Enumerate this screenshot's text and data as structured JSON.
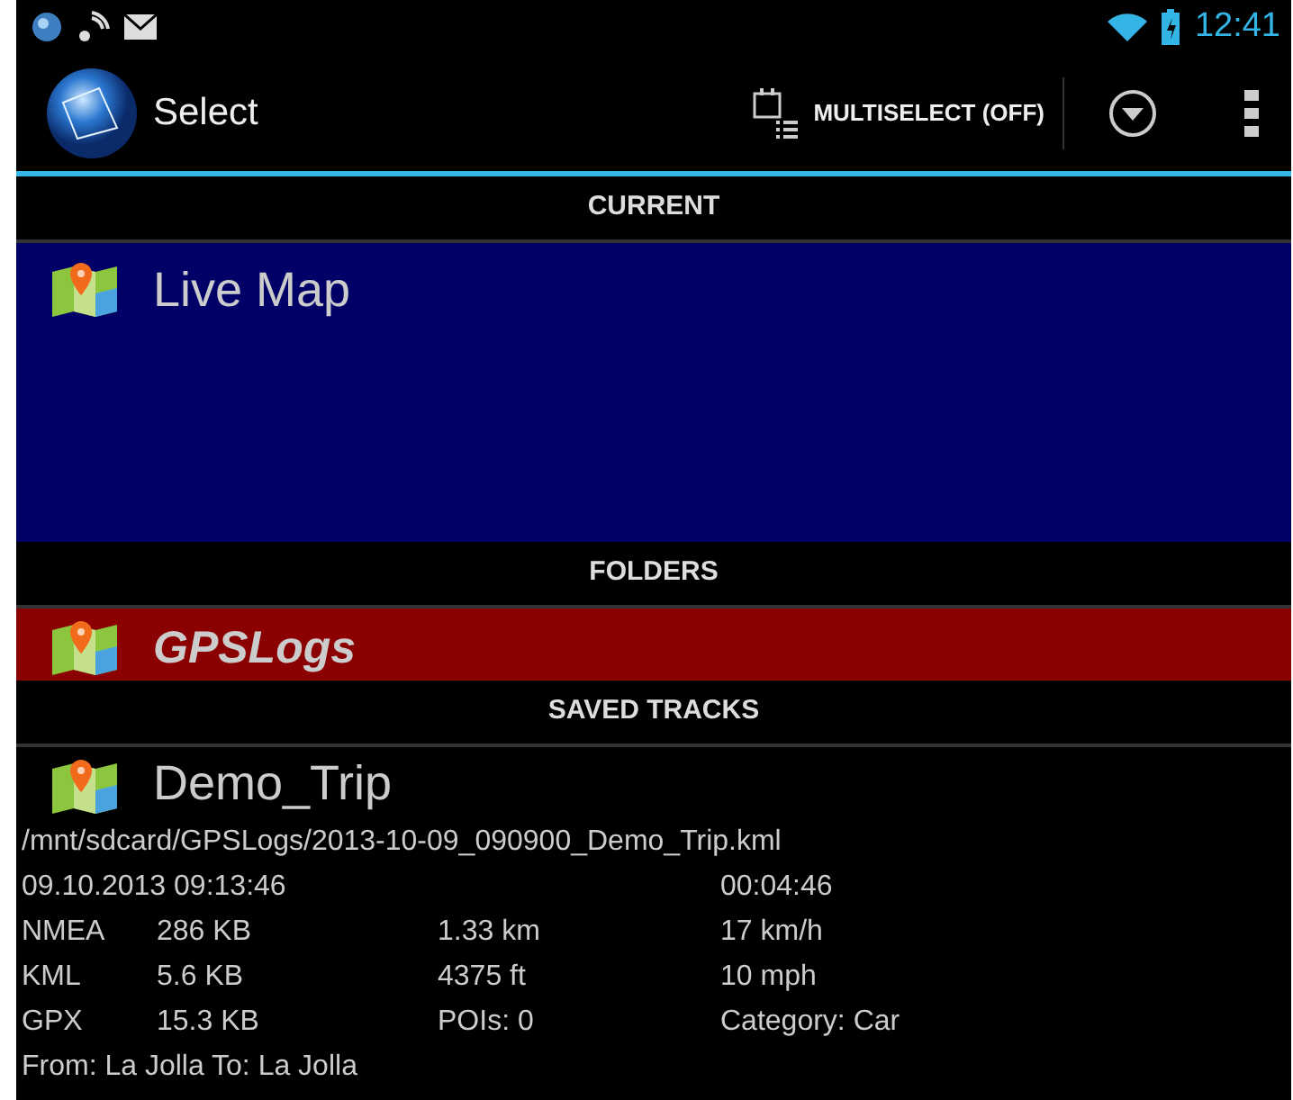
{
  "status_bar": {
    "time": "12:41"
  },
  "action_bar": {
    "title": "Select",
    "multiselect": "MULTISELECT (OFF)"
  },
  "sections": [
    {
      "header": "CURRENT",
      "items": [
        {
          "kind": "map",
          "title": "Live Map",
          "color": "#000066"
        }
      ]
    },
    {
      "header": "FOLDERS",
      "items": [
        {
          "kind": "folder",
          "title": "GPSLogs",
          "color": "#8b0000"
        }
      ]
    },
    {
      "header": "SAVED TRACKS",
      "items": [
        {
          "kind": "track",
          "title": "Demo_Trip",
          "path": "/mnt/sdcard/GPSLogs/2013-10-09_090900_Demo_Trip.kml",
          "start": "09.10.2013 09:13:46",
          "duration": "00:04:46",
          "stats": [
            {
              "format": "NMEA",
              "size": "286 KB",
              "column_3": "1.33 km",
              "column_4": "17 km/h"
            },
            {
              "format": "KML",
              "size": "5.6 KB",
              "column_3": "4375 ft",
              "column_4": "10 mph"
            },
            {
              "format": "GPX",
              "size": "15.3 KB",
              "column_3": "POIs: 0",
              "column_4": "Category: Car"
            }
          ],
          "route": "From: La Jolla To: La Jolla"
        }
      ]
    }
  ]
}
